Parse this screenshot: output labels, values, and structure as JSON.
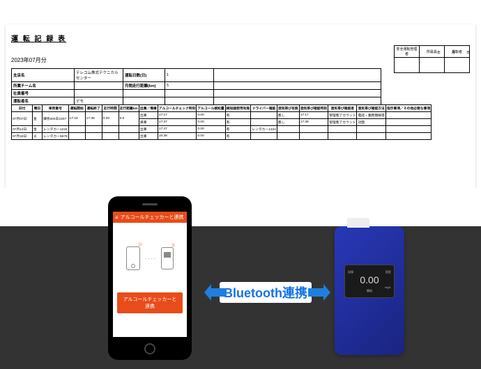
{
  "document": {
    "title": "運 転 記 録 表",
    "date_labels": {
      "year": "年",
      "month": "月",
      "day": "日"
    },
    "approval": {
      "col1": "安全運転管理者",
      "col2": "所属長",
      "col3": "運転者"
    },
    "month": "2023年07月分",
    "header": {
      "branch_label": "支店名",
      "branch_value": "テレコム株式テクニカルセンター",
      "drive_days_label": "運転日数(日)",
      "drive_days_value": "1",
      "team_label": "所属チーム名",
      "team_value": "",
      "monthly_km_label": "月間走行距離(km)",
      "monthly_km_value": "5",
      "emp_no_label": "社員番号",
      "emp_no_value": "",
      "driver_label": "運転者名",
      "driver_value": "デモ"
    },
    "columns": [
      "日付",
      "曜日",
      "車両番号",
      "運転開始",
      "運転終了",
      "走行時間",
      "走行距離km",
      "出庫／帰庫",
      "アルコールチェック時刻",
      "アルコール検知量",
      "検知器使用有無",
      "ドライバー確認",
      "酒気帯び有無",
      "酒気帯び確認時刻",
      "酒気帯び確認者",
      "酒気帯び確認方法",
      "指示事項／その他必要な事項"
    ],
    "rows": [
      {
        "c": [
          "07月07日",
          "金",
          "練馬000あ2307",
          "17:18",
          "17:38",
          "0:20",
          "5.0",
          [
            [
              "出庫",
              "17:17",
              "0.00",
              "有",
              "",
              "無し",
              "17:17",
              "管理者アカウント",
              "電話・業務無線等",
              ""
            ],
            [
              "帰庫",
              "17:37",
              "0.00",
              "有",
              "",
              "無し",
              "17:38",
              "管理者アカウント",
              "対面",
              ""
            ]
          ]
        ]
      },
      {
        "c": [
          "07月14日",
          "金",
          "レンタカー1234",
          "",
          "",
          "",
          "",
          [
            [
              "出庫",
              "17:47",
              "0.00",
              "有",
              "レンタカー1234",
              "",
              "",
              "",
              "",
              ""
            ]
          ]
        ]
      },
      {
        "c": [
          "07月18日",
          "火",
          "レンタカー5678",
          "",
          "",
          "",
          "",
          [
            [
              "出庫",
              "10:38",
              "0.00",
              "有",
              "",
              "",
              "",
              "",
              "",
              ""
            ]
          ]
        ]
      }
    ]
  },
  "phone": {
    "app_title": "アルコールチェッカーと連携",
    "button": "アルコールチェッカーと連携"
  },
  "bt_label": "Bluetooth連携",
  "device": {
    "top_left": "記録",
    "top_right": "設定",
    "value": "0.00",
    "unit": "mg/L",
    "bottom": "開始"
  }
}
